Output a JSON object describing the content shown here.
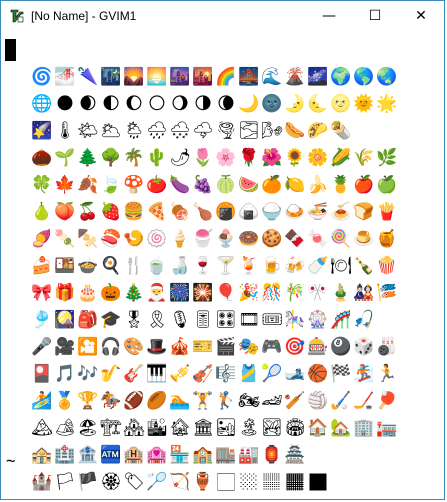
{
  "window": {
    "title": "[No Name] - GVIM1",
    "controls": {
      "minimize": "—",
      "maximize": "☐",
      "close": "✕"
    }
  },
  "editor": {
    "empty_line_marker": "~",
    "emoji_rows": [
      [
        "🌀",
        "🌁",
        "🌂",
        "🌃",
        "🌄",
        "🌅",
        "🌆",
        "🌇",
        "🌈",
        "🌉",
        "🌊",
        "🌋",
        "🌌",
        "🌍",
        "🌎",
        "🌏"
      ],
      [
        "🌐",
        "🌑",
        "🌒",
        "🌓",
        "🌔",
        "🌕",
        "🌖",
        "🌗",
        "🌘",
        "🌙",
        "🌚",
        "🌛",
        "🌜",
        "🌝",
        "🌞",
        "🌟"
      ],
      [
        "🌠",
        "🌡",
        "🌤",
        "🌥",
        "🌦",
        "🌧",
        "🌨",
        "🌩",
        "🌪",
        "🌫",
        "🌬",
        "🌭",
        "🌮",
        "🌯"
      ],
      [
        "🌰",
        "🌱",
        "🌲",
        "🌳",
        "🌴",
        "🌵",
        "🌶",
        "🌷",
        "🌸",
        "🌹",
        "🌺",
        "🌻",
        "🌼",
        "🌽",
        "🌾",
        "🌿"
      ],
      [
        "🍀",
        "🍁",
        "🍂",
        "🍃",
        "🍄",
        "🍅",
        "🍆",
        "🍇",
        "🍈",
        "🍉",
        "🍊",
        "🍋",
        "🍌",
        "🍍",
        "🍎",
        "🍏"
      ],
      [
        "🍐",
        "🍑",
        "🍒",
        "🍓",
        "🍔",
        "🍕",
        "🍖",
        "🍗",
        "🍘",
        "🍙",
        "🍚",
        "🍛",
        "🍜",
        "🍝",
        "🍞",
        "🍟"
      ],
      [
        "🍠",
        "🍡",
        "🍢",
        "🍣",
        "🍤",
        "🍥",
        "🍦",
        "🍧",
        "🍨",
        "🍩",
        "🍪",
        "🍫",
        "🍬",
        "🍭",
        "🍮",
        "🍯"
      ],
      [
        "🍰",
        "🍱",
        "🍲",
        "🍳",
        "🍴",
        "🍵",
        "🍶",
        "🍷",
        "🍸",
        "🍹",
        "🍺",
        "🍻",
        "🍼",
        "🍽",
        "🍾",
        "🍿"
      ],
      [
        "🎀",
        "🎁",
        "🎂",
        "🎃",
        "🎄",
        "🎅",
        "🎆",
        "🎇",
        "🎈",
        "🎉",
        "🎊",
        "🎋",
        "🎌",
        "🎍",
        "🎎",
        "🎏"
      ],
      [
        "🎐",
        "🎑",
        "🎒",
        "🎓",
        "🎖",
        "🎗",
        "🎙",
        "🎚",
        "🎛",
        "🎞",
        "🎟",
        "🎠",
        "🎡",
        "🎢",
        "🎣"
      ],
      [
        "🎤",
        "🎥",
        "🎦",
        "🎧",
        "🎨",
        "🎩",
        "🎪",
        "🎫",
        "🎬",
        "🎭",
        "🎮",
        "🎯",
        "🎰",
        "🎱",
        "🎲",
        "🎳"
      ],
      [
        "🎴",
        "🎵",
        "🎶",
        "🎷",
        "🎸",
        "🎹",
        "🎺",
        "🎻",
        "🎼",
        "🎽",
        "🎾",
        "🎿",
        "🏀",
        "🏁",
        "🏂",
        "🏃"
      ],
      [
        "🏄",
        "🏅",
        "🏆",
        "🏇",
        "🏈",
        "🏉",
        "🏊",
        "🏋",
        "🏌",
        "🏍",
        "🏎",
        "🏏",
        "🏐",
        "🏑",
        "🏒",
        "🏓"
      ],
      [
        "🏔",
        "🏕",
        "🏖",
        "🏗",
        "🏘",
        "🏙",
        "🏚",
        "🏛",
        "🏜",
        "🏝",
        "🏞",
        "🏟",
        "🏠",
        "🏡",
        "🏢",
        "🏣"
      ],
      [
        "🏤",
        "🏥",
        "🏦",
        "🏧",
        "🏨",
        "🏩",
        "🏪",
        "🏫",
        "🏬",
        "🏭",
        "🏮",
        "🏯"
      ],
      [
        "🏰",
        "🏳",
        "🏴",
        "🏵",
        "🏷",
        "🏸",
        "🏹",
        "🏺",
        "🏻",
        "🏼",
        "🏽",
        "🏾",
        "🏿"
      ]
    ]
  }
}
